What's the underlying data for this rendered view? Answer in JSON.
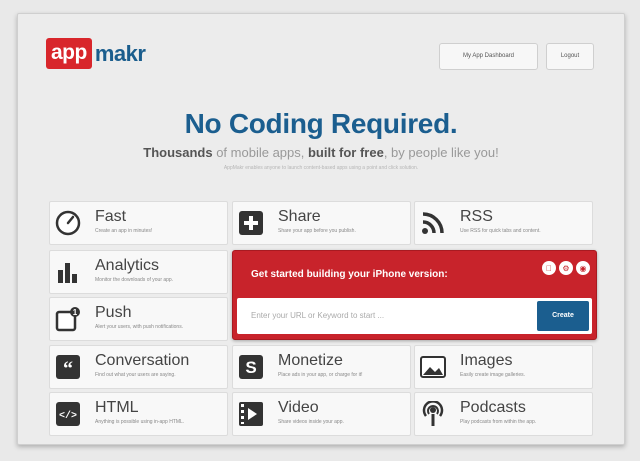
{
  "brand": {
    "part1": "app",
    "part2": "makr"
  },
  "header": {
    "dashboard_label": "My App Dashboard",
    "logout_label": "Logout"
  },
  "hero": {
    "title": "No Coding Required.",
    "subtitle_parts": [
      "Thousands",
      " of mobile apps, ",
      "built for free",
      ", by people like you!"
    ],
    "tagline": "AppMakr enables anyone to launch content-based apps using a point and click solution."
  },
  "features": [
    {
      "title": "Fast",
      "desc": "Create an app in minutes!",
      "icon": "speedometer-icon"
    },
    {
      "title": "Share",
      "desc": "Share your app before you publish.",
      "icon": "plus-icon"
    },
    {
      "title": "RSS",
      "desc": "Use RSS for quick tabs and content.",
      "icon": "rss-icon"
    },
    {
      "title": "Analytics",
      "desc": "Monitor the downloads of your app.",
      "icon": "bar-chart-icon"
    },
    {
      "title": "Push",
      "desc": "Alert your users, with push notifications.",
      "icon": "push-notification-icon"
    },
    {
      "title": "Conversation",
      "desc": "Find out what your users are saying.",
      "icon": "quote-icon"
    },
    {
      "title": "Monetize",
      "desc": "Place ads in your app, or charge for it!",
      "icon": "dollar-icon"
    },
    {
      "title": "Images",
      "desc": "Easily create image galleries.",
      "icon": "image-icon"
    },
    {
      "title": "HTML",
      "desc": "Anything is possible using in-app HTML.",
      "icon": "code-icon"
    },
    {
      "title": "Video",
      "desc": "Share videos inside your app.",
      "icon": "film-icon"
    },
    {
      "title": "Podcasts",
      "desc": "Play podcasts from within the app.",
      "icon": "podcast-icon"
    }
  ],
  "cta": {
    "message": "Get started building your iPhone version:",
    "input_placeholder": "Enter your URL or Keyword to start ...",
    "button_label": "Create",
    "platform_icons": [
      "apple-icon",
      "settings-icon",
      "android-icon"
    ]
  },
  "colors": {
    "brand_red": "#c8232b",
    "brand_blue": "#1b5e8f"
  }
}
